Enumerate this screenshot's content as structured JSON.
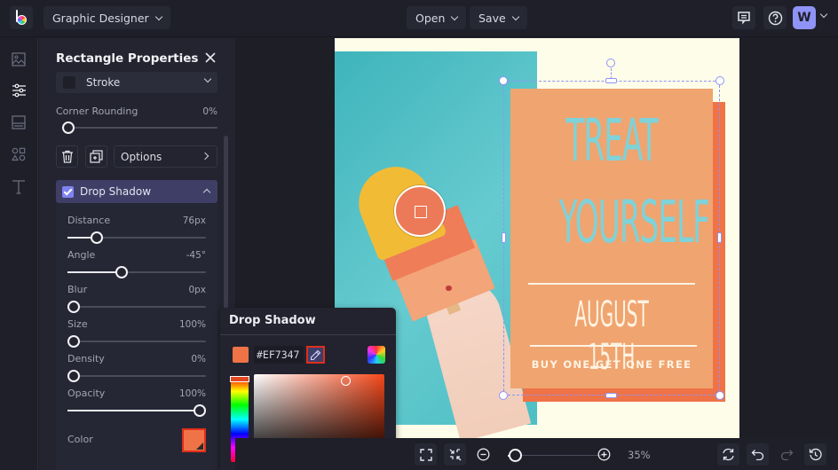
{
  "app": {
    "project_menu_label": "Graphic Designer",
    "open_label": "Open",
    "save_label": "Save",
    "avatar_initial": "W"
  },
  "rail": {
    "items": [
      {
        "name": "images",
        "icon": "image-icon",
        "active": false
      },
      {
        "name": "adjustments",
        "icon": "sliders-icon",
        "active": true
      },
      {
        "name": "backgrounds",
        "icon": "layout-icon",
        "active": false
      },
      {
        "name": "graphics",
        "icon": "shapes-icon",
        "active": false
      },
      {
        "name": "text",
        "icon": "text-icon",
        "active": false
      }
    ]
  },
  "panel": {
    "title": "Rectangle Properties",
    "stroke_label": "Stroke",
    "corner_rounding": {
      "label": "Corner Rounding",
      "value": "0%",
      "fraction": 0.0
    },
    "options_label": "Options",
    "drop_shadow": {
      "label": "Drop Shadow",
      "checked": true,
      "settings": [
        {
          "label": "Distance",
          "value": "76px",
          "fraction": 0.18
        },
        {
          "label": "Angle",
          "value": "-45°",
          "fraction": 0.38
        },
        {
          "label": "Blur",
          "value": "0px",
          "fraction": 0.0
        },
        {
          "label": "Size",
          "value": "100%",
          "fraction": 0.0
        },
        {
          "label": "Density",
          "value": "0%",
          "fraction": 0.0
        },
        {
          "label": "Opacity",
          "value": "100%",
          "fraction": 1.0
        }
      ],
      "color_label": "Color",
      "color": "#EF7347"
    }
  },
  "color_picker": {
    "title": "Drop Shadow",
    "hex_value": "#EF7347",
    "current_color": "#EF7347"
  },
  "canvas": {
    "headline_line1": "TREAT",
    "headline_line2": "YOURSELF",
    "date_text": "AUGUST 15TH",
    "promo_text": "BUY ONE GET ONE FREE",
    "colors": {
      "background": "#FEFDE9",
      "rectangle": "#F0A470",
      "shadow": "#EF7347",
      "headline": "#7FD2D8",
      "selection": "#8F93F6"
    }
  },
  "bottom_bar": {
    "zoom_level": "35%",
    "zoom_fraction": 0.05
  }
}
